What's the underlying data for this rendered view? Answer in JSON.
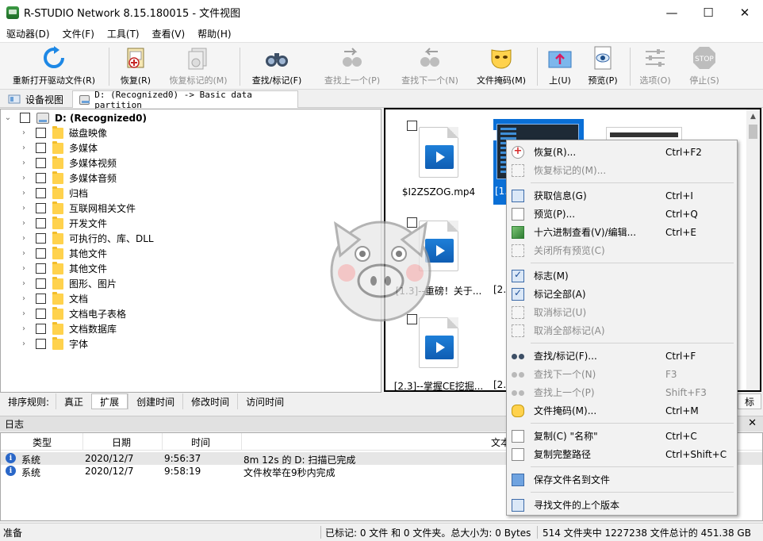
{
  "window": {
    "title": "R-STUDIO Network 8.15.180015 - 文件视图",
    "minimize": "—",
    "maximize": "☐",
    "close": "✕"
  },
  "menu": [
    "驱动器(D)",
    "文件(F)",
    "工具(T)",
    "查看(V)",
    "帮助(H)"
  ],
  "toolbar": [
    {
      "label": "重新打开驱动文件(R)",
      "icon": "refresh-icon",
      "disabled": false
    },
    {
      "label": "恢复(R)",
      "icon": "recover-icon",
      "disabled": false
    },
    {
      "label": "恢复标记的(M)",
      "icon": "recover-marked-icon",
      "disabled": true
    },
    {
      "label": "查找/标记(F)",
      "icon": "binoculars-icon",
      "disabled": false
    },
    {
      "label": "查找上一个(P)",
      "icon": "find-previous-icon",
      "disabled": true
    },
    {
      "label": "查找下一个(N)",
      "icon": "find-next-icon",
      "disabled": true
    },
    {
      "label": "文件掩码(M)",
      "icon": "file-mask-icon",
      "disabled": false
    },
    {
      "label": "上(U)",
      "icon": "folder-up-icon",
      "disabled": false
    },
    {
      "label": "预览(P)",
      "icon": "preview-icon",
      "disabled": false
    },
    {
      "label": "选项(O)",
      "icon": "options-icon",
      "disabled": true
    },
    {
      "label": "停止(S)",
      "icon": "stop-icon",
      "disabled": true
    }
  ],
  "tabs": {
    "device_view": "设备视图",
    "partition": "D: (Recognized0) -> Basic data partition"
  },
  "tree": {
    "root": "D: (Recognized0)",
    "items": [
      "磁盘映像",
      "多媒体",
      "多媒体视频",
      "多媒体音频",
      "归档",
      "互联网相关文件",
      "开发文件",
      "可执行的、库、DLL",
      "其他文件",
      "其他文件",
      "图形、图片",
      "文档",
      "文档电子表格",
      "文档数据库",
      "字体"
    ]
  },
  "files": {
    "items": [
      {
        "name": "$I2ZSZOG.mp4"
      },
      {
        "name": "[1.3]--重磅！关于..."
      },
      {
        "name": "[2.3]--掌握CE挖掘..."
      }
    ],
    "selected_label": "[1.",
    "partial_labels": [
      "[2.",
      "[2.4"
    ]
  },
  "sortbar": {
    "label": "排序规则:",
    "buttons": [
      "真正",
      "扩展",
      "创建时间",
      "修改时间",
      "访问时间"
    ],
    "active": "扩展",
    "right_button": "标"
  },
  "log": {
    "title": "日志",
    "close": "✕",
    "columns": [
      "类型",
      "日期",
      "时间",
      "文本"
    ],
    "rows": [
      {
        "type": "系统",
        "date": "2020/12/7",
        "time": "9:56:37",
        "text": "8m 12s 的 D: 扫描已完成"
      },
      {
        "type": "系统",
        "date": "2020/12/7",
        "time": "9:58:19",
        "text": "文件枚举在9秒内完成"
      }
    ]
  },
  "status": {
    "ready": "准备",
    "marked": "已标记: 0 文件 和 0 文件夹。总大小为: 0 Bytes",
    "totals": "514 文件夹中 1227238 文件总计的 451.38 GB"
  },
  "context_menu": [
    {
      "label": "恢复(R)...",
      "key": "Ctrl+F2",
      "icon": "recover-icon",
      "disabled": false
    },
    {
      "label": "恢复标记的(M)...",
      "key": "",
      "icon": "recover-marked-icon",
      "disabled": true
    },
    {
      "sep": true
    },
    {
      "label": "获取信息(G)",
      "key": "Ctrl+I",
      "icon": "info-icon",
      "disabled": false
    },
    {
      "label": "预览(P)...",
      "key": "Ctrl+Q",
      "icon": "preview-icon",
      "disabled": false
    },
    {
      "label": "十六进制查看(V)/编辑...",
      "key": "Ctrl+E",
      "icon": "hex-icon",
      "disabled": false
    },
    {
      "label": "关闭所有预览(C)",
      "key": "",
      "icon": "close-previews-icon",
      "disabled": true
    },
    {
      "sep": true
    },
    {
      "label": "标志(M)",
      "key": "",
      "icon": "mark-icon",
      "disabled": false
    },
    {
      "label": "标记全部(A)",
      "key": "",
      "icon": "mark-all-icon",
      "disabled": false
    },
    {
      "label": "取消标记(U)",
      "key": "",
      "icon": "unmark-icon",
      "disabled": true
    },
    {
      "label": "取消全部标记(A)",
      "key": "",
      "icon": "unmark-all-icon",
      "disabled": true
    },
    {
      "sep": true
    },
    {
      "label": "查找/标记(F)...",
      "key": "Ctrl+F",
      "icon": "binoculars-icon",
      "disabled": false
    },
    {
      "label": "查找下一个(N)",
      "key": "F3",
      "icon": "find-next-icon",
      "disabled": true
    },
    {
      "label": "查找上一个(P)",
      "key": "Shift+F3",
      "icon": "find-previous-icon",
      "disabled": true
    },
    {
      "label": "文件掩码(M)...",
      "key": "Ctrl+M",
      "icon": "file-mask-icon",
      "disabled": false
    },
    {
      "sep": true
    },
    {
      "label": "复制(C) \"名称\"",
      "key": "Ctrl+C",
      "icon": "copy-icon",
      "disabled": false
    },
    {
      "label": "复制完整路径",
      "key": "Ctrl+Shift+C",
      "icon": "copy-path-icon",
      "disabled": false
    },
    {
      "sep": true
    },
    {
      "label": "保存文件名到文件",
      "key": "",
      "icon": "save-names-icon",
      "disabled": false
    },
    {
      "sep": true
    },
    {
      "label": "寻找文件的上个版本",
      "key": "",
      "icon": "previous-version-icon",
      "disabled": false
    }
  ],
  "colors": {
    "selection": "#0a6fd6",
    "folder": "#ffd24d",
    "disabled_text": "#8a8a8a"
  }
}
